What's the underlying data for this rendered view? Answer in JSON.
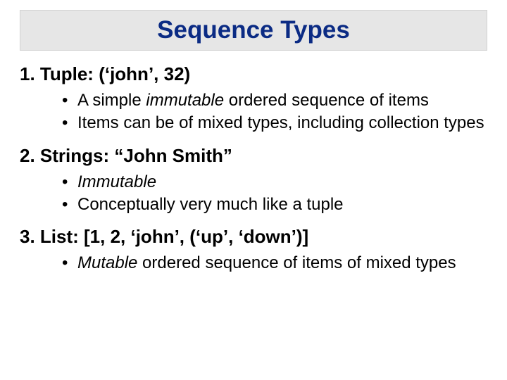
{
  "title": "Sequence Types",
  "sections": [
    {
      "heading": "1. Tuple: (‘john’, 32)",
      "bullets": [
        {
          "pre": "A simple ",
          "emph": "immutable",
          "post": " ordered sequence of items"
        },
        {
          "pre": "Items can be of mixed types, including collection types",
          "emph": "",
          "post": ""
        }
      ]
    },
    {
      "heading": "2. Strings: “John Smith”",
      "bullets": [
        {
          "pre": "",
          "emph": "Immutable",
          "post": ""
        },
        {
          "pre": "Conceptually very much like a tuple",
          "emph": "",
          "post": ""
        }
      ]
    },
    {
      "heading": "3. List: [1, 2, ‘john’, (‘up’, ‘down’)]",
      "bullets": [
        {
          "pre": "",
          "emph": "Mutable",
          "post": " ordered sequence of items of mixed types"
        }
      ]
    }
  ]
}
